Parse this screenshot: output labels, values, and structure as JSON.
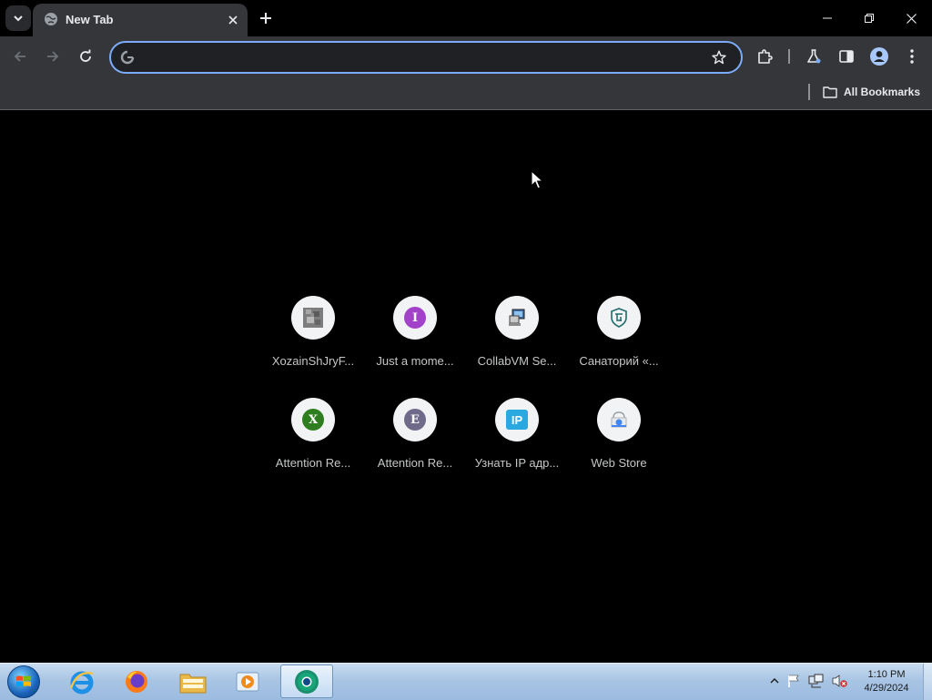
{
  "browser": {
    "tab": {
      "title": "New Tab",
      "close_label": "×"
    },
    "new_tab_label": "+",
    "omnibox": {
      "value": "",
      "placeholder": ""
    },
    "bookmarks": {
      "all_bookmarks_label": "All Bookmarks"
    },
    "accent_color": "#7cacf8"
  },
  "shortcuts": [
    {
      "label": "XozainShJryF...",
      "icon": "grey-pixel-favicon"
    },
    {
      "label": "Just a mome...",
      "icon": "letter-I",
      "letter": "I",
      "color": "#a142c9"
    },
    {
      "label": "CollabVM Se...",
      "icon": "computer-favicon"
    },
    {
      "label": "Санаторий «...",
      "icon": "shield-emblem-favicon"
    },
    {
      "label": "Attention Re...",
      "icon": "letter-X",
      "letter": "X",
      "color": "#2e7d1f"
    },
    {
      "label": "Attention Re...",
      "icon": "letter-E",
      "letter": "E",
      "color": "#6f6a8a"
    },
    {
      "label": "Узнать IP адр...",
      "icon": "ip-favicon",
      "badge": "IP"
    },
    {
      "label": "Web Store",
      "icon": "web-store-favicon"
    }
  ],
  "taskbar": {
    "apps": [
      "internet-explorer",
      "firefox",
      "file-explorer",
      "media-player",
      "chrome"
    ],
    "clock": {
      "time": "1:10 PM",
      "date": "4/29/2024"
    }
  }
}
